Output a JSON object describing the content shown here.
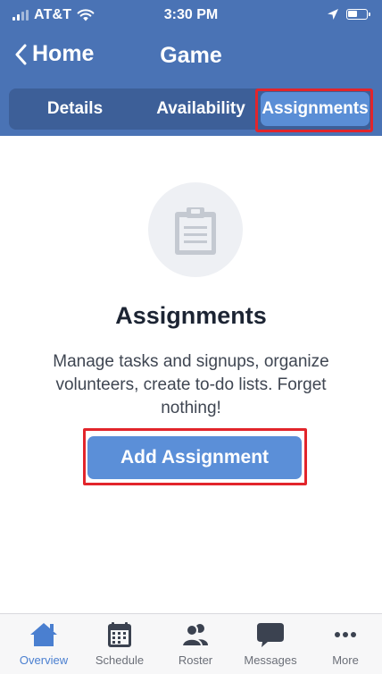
{
  "status_bar": {
    "carrier": "AT&T",
    "time": "3:30 PM",
    "battery_level": 0.58
  },
  "nav": {
    "back_label": "Home",
    "title": "Game"
  },
  "tabs": [
    {
      "label": "Details"
    },
    {
      "label": "Availability"
    },
    {
      "label": "Assignments",
      "selected": true
    }
  ],
  "empty_state": {
    "icon": "clipboard-icon",
    "title": "Assignments",
    "description": "Manage tasks and signups, organize volunteers, create to-do lists. Forget nothing!",
    "button_label": "Add Assignment"
  },
  "bottom_nav": [
    {
      "label": "Overview",
      "icon": "home-icon",
      "active": true
    },
    {
      "label": "Schedule",
      "icon": "calendar-icon"
    },
    {
      "label": "Roster",
      "icon": "people-icon"
    },
    {
      "label": "Messages",
      "icon": "chat-bubble-icon"
    },
    {
      "label": "More",
      "icon": "more-dots-icon"
    }
  ],
  "colors": {
    "header_blue": "#4a73b5",
    "tabs_bg": "#3d5f98",
    "selected_tab": "#5a8ed6",
    "button_blue": "#5b8fd8",
    "highlight_red": "#e2252b",
    "active_nav": "#4a7fd0",
    "inactive_nav": "#3b4250"
  }
}
